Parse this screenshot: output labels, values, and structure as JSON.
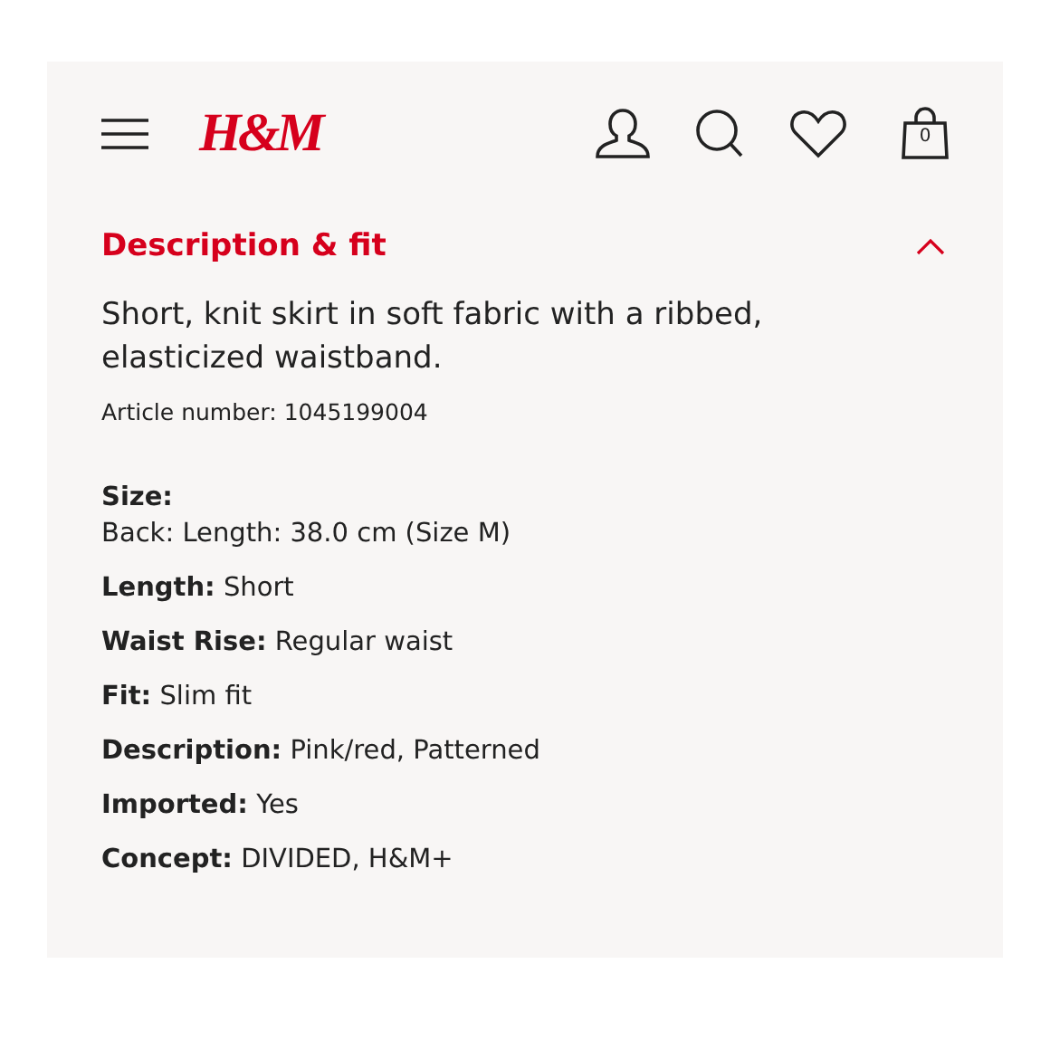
{
  "header": {
    "logo": "H&M",
    "cart_count": "0"
  },
  "section": {
    "title": "Description & fit",
    "expanded": true,
    "description": "Short, knit skirt in soft fabric with a ribbed, elasticized waistband.",
    "article_label": "Article number:",
    "article_number": "1045199004",
    "attributes": [
      {
        "kind": "block",
        "label": "Size:",
        "value": "Back: Length: 38.0 cm (Size M)"
      },
      {
        "kind": "inline",
        "label": "Length:",
        "value": "Short"
      },
      {
        "kind": "inline",
        "label": "Waist Rise:",
        "value": "Regular waist"
      },
      {
        "kind": "inline",
        "label": "Fit:",
        "value": "Slim fit"
      },
      {
        "kind": "inline",
        "label": "Description:",
        "value": "Pink/red, Patterned"
      },
      {
        "kind": "inline",
        "label": "Imported:",
        "value": "Yes"
      },
      {
        "kind": "inline",
        "label": "Concept:",
        "value": "DIVIDED, H&M+"
      }
    ]
  }
}
